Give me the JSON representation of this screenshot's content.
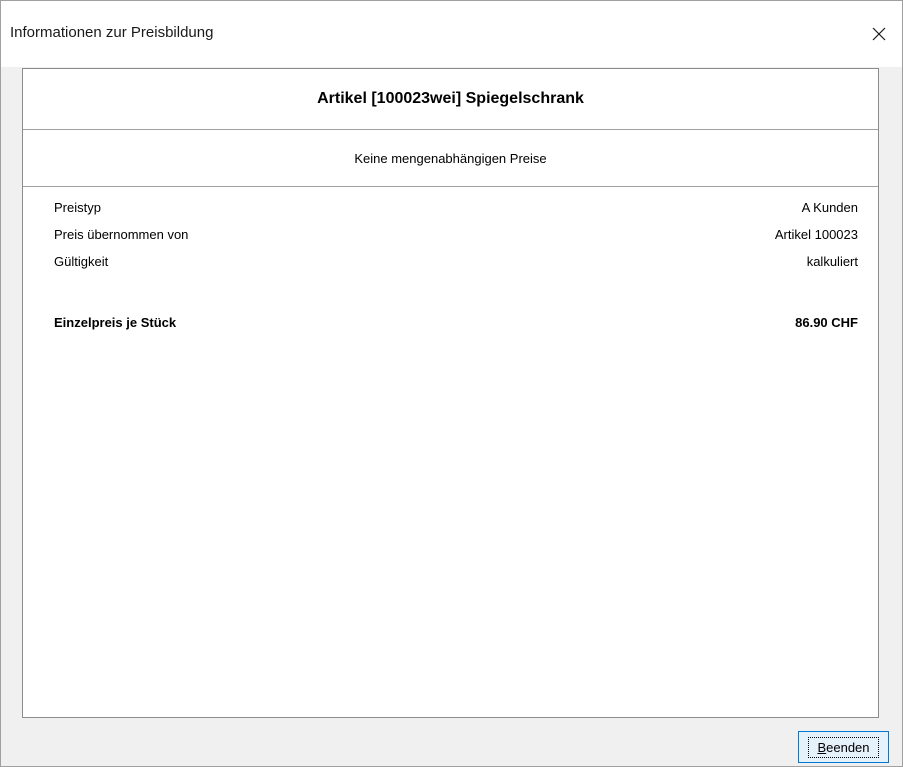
{
  "window": {
    "title": "Informationen zur Preisbildung"
  },
  "article": {
    "title": "Artikel [100023wei] Spiegelschrank",
    "quantity_note": "Keine mengenabhängigen Preise"
  },
  "details": [
    {
      "label": "Preistyp",
      "value": "A Kunden"
    },
    {
      "label": "Preis übernommen von",
      "value": "Artikel 100023"
    },
    {
      "label": "Gültigkeit",
      "value": "kalkuliert"
    }
  ],
  "unit_price": {
    "label": "Einzelpreis je Stück",
    "value": "86.90 CHF"
  },
  "buttons": {
    "end_mnemonic": "B",
    "end_rest": "eenden"
  },
  "icons": {
    "close": "close-icon"
  },
  "colors": {
    "button_border": "#0078d7",
    "button_fill": "#e5f1fb",
    "dialog_background": "#f0f0f0"
  }
}
